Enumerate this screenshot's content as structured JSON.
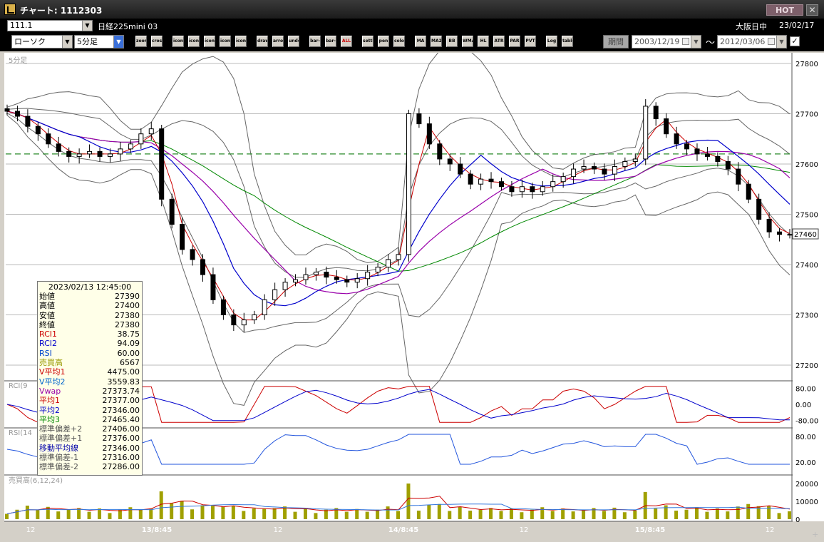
{
  "window": {
    "title": "チャート: 1112303",
    "hot_label": "HOT",
    "close_label": "✕"
  },
  "header": {
    "symbol_code": "111.1",
    "symbol_name": "日経225mini 03",
    "market": "大阪日中",
    "date": "23/02/17"
  },
  "toolbar": {
    "chart_type": "ローソク",
    "period": "5分足",
    "buttons": [
      "zoom-in",
      "cross",
      "icon1",
      "icon2",
      "icon3",
      "icon4",
      "icon5",
      "draw",
      "arrow",
      "undo",
      "bar-left",
      "bar-right",
      "ALL",
      "settings",
      "pen",
      "color",
      "MA",
      "MA2",
      "BB",
      "WMA",
      "HL",
      "ATR",
      "PAR",
      "PVT",
      "Log",
      "table"
    ],
    "kikan_label": "期間",
    "date_from": "2003/12/19",
    "tilde": "〜",
    "date_to": "2012/03/06",
    "check_mark": "✓"
  },
  "chart": {
    "main_label": "5分足",
    "rci_label": "RCI(9",
    "rsi_label": "RSI(14",
    "volume_label": "売買高(6,12,24)",
    "current_price": "27460",
    "price_ticks": [
      "27800",
      "27700",
      "27600",
      "27500",
      "27400",
      "27300",
      "27200"
    ],
    "rci_ticks": [
      "80.00",
      "0.00",
      "-80.00"
    ],
    "rsi_ticks": [
      "80.00",
      "20.00"
    ],
    "volume_ticks": [
      "20000",
      "10000",
      "0"
    ],
    "x_labels": [
      "12",
      "13/8:45",
      "12",
      "14/8:45",
      "12",
      "15/8:45",
      "12"
    ]
  },
  "chart_data": {
    "type": "candlestick",
    "title": "5分足",
    "y_range": [
      27200,
      27800
    ],
    "reference_line": 27620,
    "last_price": 27460,
    "series_close": [
      27705,
      27695,
      27675,
      27660,
      27640,
      27625,
      27615,
      27620,
      27625,
      27615,
      27620,
      27630,
      27640,
      27660,
      27670,
      27530,
      27480,
      27430,
      27410,
      27380,
      27330,
      27300,
      27280,
      27290,
      27300,
      27330,
      27350,
      27365,
      27370,
      27380,
      27385,
      27375,
      27370,
      27365,
      27372,
      27385,
      27395,
      27410,
      27420,
      27700,
      27680,
      27640,
      27610,
      27600,
      27580,
      27560,
      27570,
      27565,
      27555,
      27545,
      27555,
      27545,
      27555,
      27565,
      27575,
      27590,
      27595,
      27590,
      27580,
      27595,
      27605,
      27610,
      27715,
      27690,
      27660,
      27640,
      27630,
      27620,
      27615,
      27605,
      27590,
      27560,
      27530,
      27490,
      27465,
      27460,
      27460
    ],
    "indicators": [
      "RCI1",
      "RCI2",
      "RSI",
      "Vwap",
      "平均1",
      "平均2",
      "平均3",
      "標準偏差+2",
      "標準偏差+1",
      "移動平均線",
      "標準偏差-1",
      "標準偏差-2"
    ]
  },
  "info_panel": {
    "timestamp": "2023/02/13 12:45:00",
    "rows": [
      {
        "label": "始値",
        "value": "27390",
        "color": "#000000"
      },
      {
        "label": "高値",
        "value": "27400",
        "color": "#000000"
      },
      {
        "label": "安値",
        "value": "27380",
        "color": "#000000"
      },
      {
        "label": "終値",
        "value": "27380",
        "color": "#000000"
      },
      {
        "label": "RCI1",
        "value": "38.75",
        "color": "#cc0000"
      },
      {
        "label": "RCI2",
        "value": "94.09",
        "color": "#0000cc"
      },
      {
        "label": "RSI",
        "value": "60.00",
        "color": "#0044cc"
      },
      {
        "label": "売買高",
        "value": "6567",
        "color": "#999900"
      },
      {
        "label": "V平均1",
        "value": "4475.00",
        "color": "#cc0000"
      },
      {
        "label": "V平均2",
        "value": "3559.83",
        "color": "#0066cc"
      },
      {
        "label": "Vwap",
        "value": "27373.74",
        "color": "#9900aa"
      },
      {
        "label": "平均1",
        "value": "27377.00",
        "color": "#cc0000"
      },
      {
        "label": "平均2",
        "value": "27346.00",
        "color": "#0000cc"
      },
      {
        "label": "平均3",
        "value": "27465.40",
        "color": "#008800"
      },
      {
        "label": "標準偏差+2",
        "value": "27406.00",
        "color": "#555555"
      },
      {
        "label": "標準偏差+1",
        "value": "27376.00",
        "color": "#555555"
      },
      {
        "label": "移動平均線",
        "value": "27346.00",
        "color": "#0000aa"
      },
      {
        "label": "標準偏差-1",
        "value": "27316.00",
        "color": "#555555"
      },
      {
        "label": "標準偏差-2",
        "value": "27286.00",
        "color": "#555555"
      }
    ]
  },
  "colors": {
    "chart_bg": "#ffffff",
    "candle": "#000000",
    "ma1": "#cc0000",
    "ma2": "#0000cc",
    "ma3": "#008800",
    "vwap": "#9900aa",
    "bands": "#666666",
    "volume_bar": "#a0a000"
  }
}
